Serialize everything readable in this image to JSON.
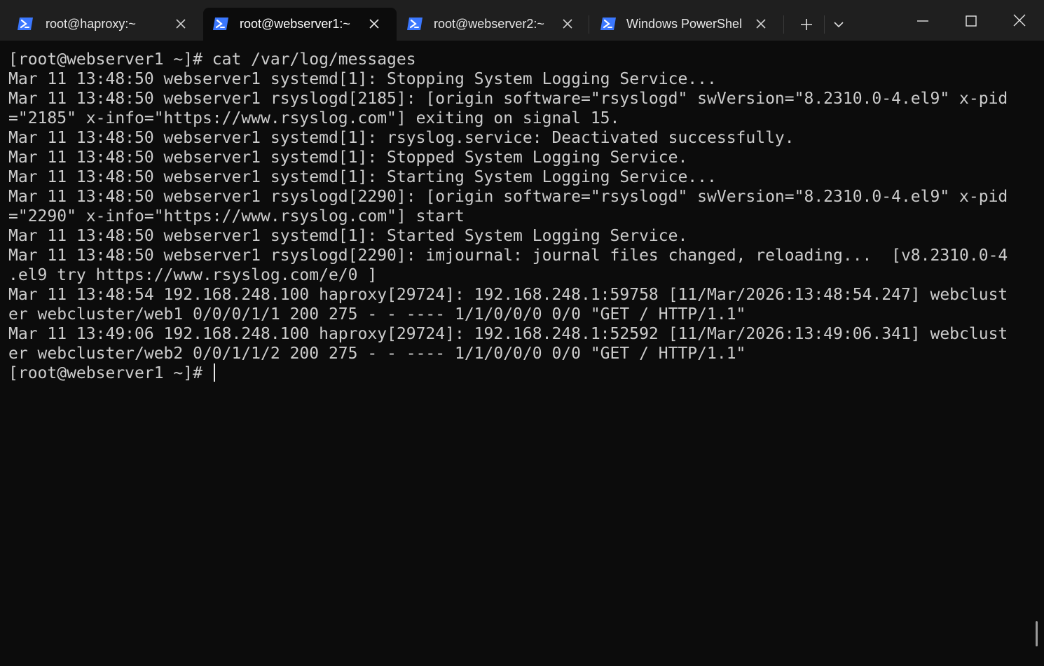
{
  "tabs": [
    {
      "title": "root@haproxy:~",
      "icon": "powershell-icon",
      "active": false
    },
    {
      "title": "root@webserver1:~",
      "icon": "powershell-icon",
      "active": true
    },
    {
      "title": "root@webserver2:~",
      "icon": "powershell-icon",
      "active": false
    },
    {
      "title": "Windows PowerShel",
      "icon": "powershell-icon",
      "active": false
    }
  ],
  "toolbar": {
    "new_tab_icon": "plus-icon",
    "dropdown_icon": "chevron-down-icon"
  },
  "window_controls": {
    "minimize_icon": "minimize-icon",
    "maximize_icon": "maximize-icon",
    "close_icon": "close-icon"
  },
  "colors": {
    "terminal_bg": "#0c0c0c",
    "tabbar_bg": "#1f1f1f",
    "text": "#cccccc",
    "icon_blue": "#3b78ff"
  },
  "terminal": {
    "lines": [
      "[root@webserver1 ~]# cat /var/log/messages",
      "Mar 11 13:48:50 webserver1 systemd[1]: Stopping System Logging Service...",
      "Mar 11 13:48:50 webserver1 rsyslogd[2185]: [origin software=\"rsyslogd\" swVersion=\"8.2310.0-4.el9\" x-pid",
      "=\"2185\" x-info=\"https://www.rsyslog.com\"] exiting on signal 15.",
      "Mar 11 13:48:50 webserver1 systemd[1]: rsyslog.service: Deactivated successfully.",
      "Mar 11 13:48:50 webserver1 systemd[1]: Stopped System Logging Service.",
      "Mar 11 13:48:50 webserver1 systemd[1]: Starting System Logging Service...",
      "Mar 11 13:48:50 webserver1 rsyslogd[2290]: [origin software=\"rsyslogd\" swVersion=\"8.2310.0-4.el9\" x-pid",
      "=\"2290\" x-info=\"https://www.rsyslog.com\"] start",
      "Mar 11 13:48:50 webserver1 systemd[1]: Started System Logging Service.",
      "Mar 11 13:48:50 webserver1 rsyslogd[2290]: imjournal: journal files changed, reloading...  [v8.2310.0-4",
      ".el9 try https://www.rsyslog.com/e/0 ]",
      "Mar 11 13:48:54 192.168.248.100 haproxy[29724]: 192.168.248.1:59758 [11/Mar/2026:13:48:54.247] webclust",
      "er webcluster/web1 0/0/0/1/1 200 275 - - ---- 1/1/0/0/0 0/0 \"GET / HTTP/1.1\"",
      "Mar 11 13:49:06 192.168.248.100 haproxy[29724]: 192.168.248.1:52592 [11/Mar/2026:13:49:06.341] webclust",
      "er webcluster/web2 0/0/1/1/2 200 275 - - ---- 1/1/0/0/0 0/0 \"GET / HTTP/1.1\""
    ],
    "prompt": "[root@webserver1 ~]# "
  }
}
